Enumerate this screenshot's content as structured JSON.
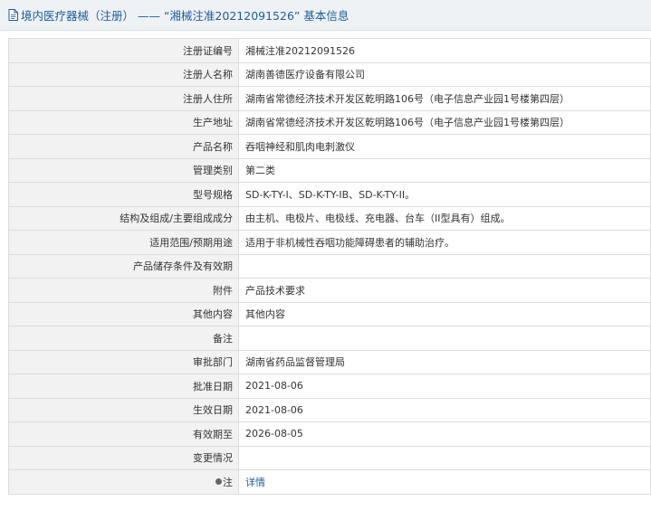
{
  "header": {
    "title": "境内医疗器械（注册） —— “湘械注准20212091526” 基本信息"
  },
  "rows": [
    {
      "label": "注册证编号",
      "value": "湘械注准20212091526"
    },
    {
      "label": "注册人名称",
      "value": "湖南善德医疗设备有限公司"
    },
    {
      "label": "注册人住所",
      "value": "湖南省常德经济技术开发区乾明路106号（电子信息产业园1号楼第四层）"
    },
    {
      "label": "生产地址",
      "value": "湖南省常德经济技术开发区乾明路106号（电子信息产业园1号楼第四层）"
    },
    {
      "label": "产品名称",
      "value": "吞咽神经和肌肉电刺激仪"
    },
    {
      "label": "管理类别",
      "value": "第二类"
    },
    {
      "label": "型号规格",
      "value": "SD-K-TY-I、SD-K-TY-IB、SD-K-TY-II。"
    },
    {
      "label": "结构及组成/主要组成成分",
      "value": "由主机、电极片、电极线、充电器、台车（II型具有）组成。"
    },
    {
      "label": "适用范围/预期用途",
      "value": "适用于非机械性吞咽功能障碍患者的辅助治疗。"
    },
    {
      "label": "产品储存条件及有效期",
      "value": ""
    },
    {
      "label": "附件",
      "value": "产品技术要求"
    },
    {
      "label": "其他内容",
      "value": "其他内容"
    },
    {
      "label": "备注",
      "value": ""
    },
    {
      "label": "审批部门",
      "value": "湖南省药品监督管理局"
    },
    {
      "label": "批准日期",
      "value": "2021-08-06"
    },
    {
      "label": "生效日期",
      "value": "2021-08-06"
    },
    {
      "label": "有效期至",
      "value": "2026-08-05"
    },
    {
      "label": "变更情况",
      "value": ""
    }
  ],
  "note_row": {
    "label": "注",
    "link": "详情"
  }
}
